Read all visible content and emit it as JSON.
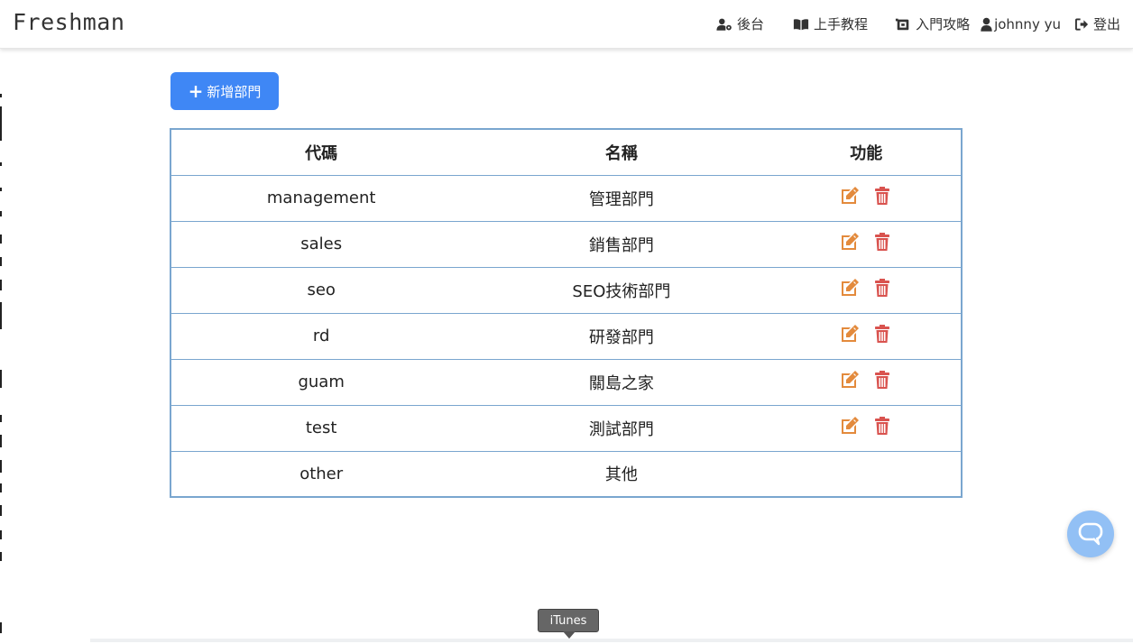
{
  "brand": "Freshman",
  "nav": {
    "backend": "後台",
    "tutorial": "上手教程",
    "guide": "入門攻略",
    "user": "johnny yu",
    "logout": "登出"
  },
  "add_button": "新增部門",
  "table": {
    "headers": [
      "代碼",
      "名稱",
      "功能"
    ],
    "rows": [
      {
        "code": "management",
        "name": "管理部門",
        "actions": true
      },
      {
        "code": "sales",
        "name": "銷售部門",
        "actions": true
      },
      {
        "code": "seo",
        "name": "SEO技術部門",
        "actions": true
      },
      {
        "code": "rd",
        "name": "研發部門",
        "actions": true
      },
      {
        "code": "guam",
        "name": "關島之家",
        "actions": true
      },
      {
        "code": "test",
        "name": "測試部門",
        "actions": true
      },
      {
        "code": "other",
        "name": "其他",
        "actions": false
      }
    ]
  },
  "tooltip": "iTunes",
  "colors": {
    "primary": "#3f87f5",
    "edit": "#e38a3c",
    "delete": "#d9534f",
    "table_border": "#7aa6cf"
  },
  "icons": {
    "backend": "user-gear-icon",
    "tutorial": "book-open-icon",
    "guide": "map-guide-icon",
    "user": "user-icon",
    "logout": "sign-out-icon",
    "edit": "edit-icon",
    "delete": "trash-icon",
    "chat": "chat-bubble-icon"
  }
}
